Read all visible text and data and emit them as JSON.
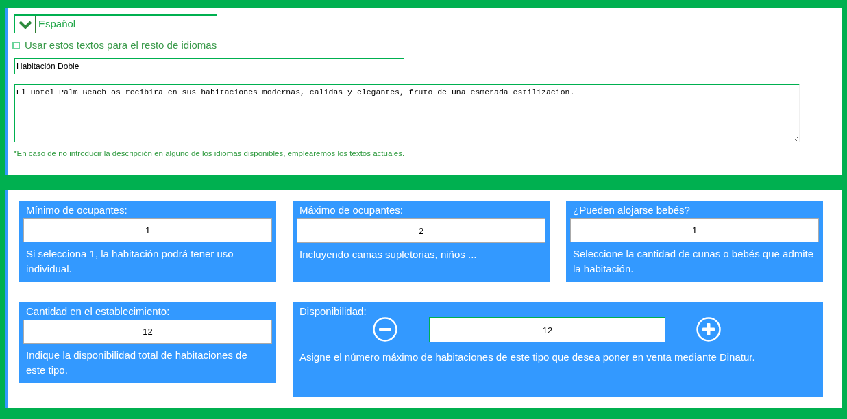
{
  "language_section": {
    "title": "Español",
    "expanded": true,
    "use_for_all": {
      "label": "Usar estos textos para el resto de idiomas",
      "checked": false
    },
    "name_value": "Habitación Doble",
    "description_value": "El Hotel Palm Beach os recibira en sus habitaciones modernas, calidas y elegantes, fruto de una esmerada estilizacion.",
    "note": "*En caso de no introducir la descripción en alguno de los idiomas disponibles, emplearemos los textos actuales."
  },
  "settings": [
    {
      "kind": "field",
      "label": "Mínimo de ocupantes:",
      "value": "1",
      "help": "Si selecciona 1, la habitación podrá tener uso individual."
    },
    {
      "kind": "field",
      "label": "Máximo de ocupantes:",
      "value": "2",
      "help": "Incluyendo camas supletorias, niños ..."
    },
    {
      "kind": "field",
      "label": "¿Pueden alojarse bebés?",
      "value": "1",
      "help": "Seleccione la cantidad de cunas o bebés que admite la habitación."
    },
    {
      "kind": "field",
      "label": "Cantidad en el establecimiento:",
      "value": "12",
      "help": "Indique la disponibilidad total de habitaciones de este tipo."
    },
    {
      "kind": "stepper",
      "label": "Disponibilidad:",
      "value": "12",
      "help": "Asigne el número máximo de habitaciones de este tipo que desea poner en venta mediante Dinatur."
    }
  ]
}
